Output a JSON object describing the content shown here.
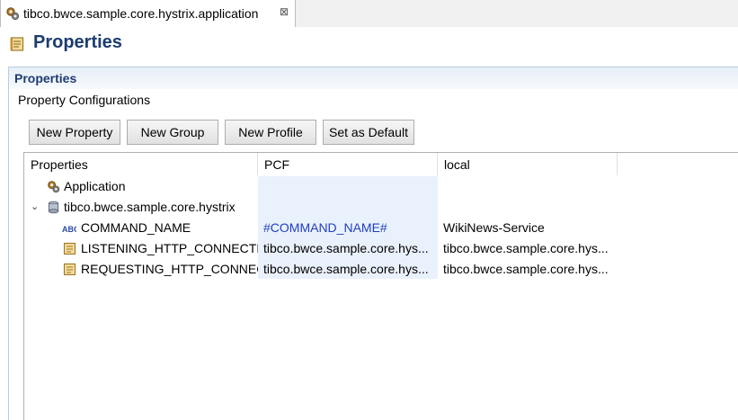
{
  "tab": {
    "title": "tibco.bwce.sample.core.hystrix.application",
    "close": "⊠"
  },
  "header": {
    "title": "Properties"
  },
  "section": {
    "title": "Properties",
    "subtitle": "Property Configurations"
  },
  "buttons": {
    "new_property": "New Property",
    "new_group": "New Group",
    "new_profile": "New Profile",
    "set_default": "Set as Default"
  },
  "table": {
    "columns": [
      "Properties",
      "PCF",
      "local"
    ],
    "rows": [
      {
        "name": "Application",
        "icon": "gears-icon",
        "pcf": "",
        "local": ""
      },
      {
        "name": "tibco.bwce.sample.core.hystrix",
        "icon": "module-icon",
        "expander": "⌄",
        "pcf": "",
        "local": ""
      },
      {
        "name": "COMMAND_NAME",
        "icon": "abc-string-icon",
        "pcf": "#COMMAND_NAME#",
        "local": "WikiNews-Service"
      },
      {
        "name": "LISTENING_HTTP_CONNECTIC",
        "icon": "property-icon",
        "pcf": "tibco.bwce.sample.core.hys...",
        "local": "tibco.bwce.sample.core.hys..."
      },
      {
        "name": "REQUESTING_HTTP_CONNECT",
        "icon": "property-icon",
        "pcf": "tibco.bwce.sample.core.hys...",
        "local": "tibco.bwce.sample.core.hys..."
      }
    ]
  }
}
